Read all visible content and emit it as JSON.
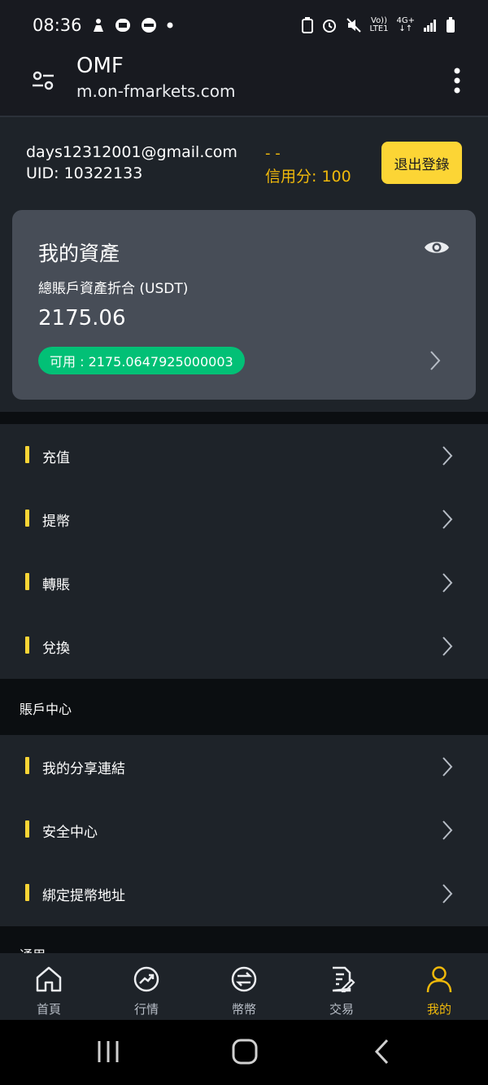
{
  "status_bar": {
    "time": "08:36",
    "notification_icons": [
      "person-icon",
      "app-icon",
      "line-icon",
      "dot-icon"
    ],
    "network_top": "Vo))",
    "network_bottom": "LTE1",
    "signal_top": "4G+",
    "signal_bottom": "↓↑"
  },
  "app_bar": {
    "title": "OMF",
    "url": "m.on-fmarkets.com"
  },
  "account": {
    "email": "days12312001@gmail.com",
    "uid": "UID: 10322133",
    "dash": "- -",
    "credit": "信用分: 100",
    "logout_label": "退出登錄"
  },
  "assets": {
    "title": "我的資產",
    "subtitle": "總賬戶資產折合 (USDT)",
    "total": "2175.06",
    "available": "可用 : 2175.0647925000003"
  },
  "menu_primary": [
    {
      "label": "充值"
    },
    {
      "label": "提幣"
    },
    {
      "label": "轉賬"
    },
    {
      "label": "兌換"
    }
  ],
  "account_center": {
    "header": "賬戶中心",
    "items": [
      {
        "label": "我的分享連結"
      },
      {
        "label": "安全中心"
      },
      {
        "label": "綁定提幣地址"
      }
    ]
  },
  "general_header": "通用",
  "bottom_nav": [
    {
      "label": "首頁",
      "icon": "home-icon"
    },
    {
      "label": "行情",
      "icon": "market-icon"
    },
    {
      "label": "幣幣",
      "icon": "exchange-icon"
    },
    {
      "label": "交易",
      "icon": "trade-icon"
    },
    {
      "label": "我的",
      "icon": "profile-icon",
      "active": true
    }
  ],
  "colors": {
    "accent": "#fcd535",
    "accent_text": "#f0b90b",
    "green": "#02c076",
    "background": "#181a20",
    "card": "#474d57"
  }
}
